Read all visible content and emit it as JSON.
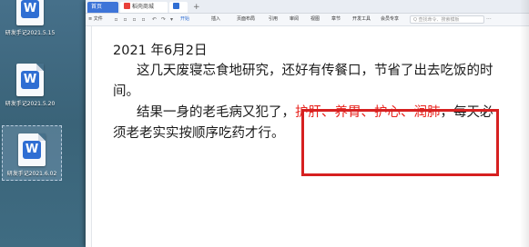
{
  "desktop": {
    "icons": [
      {
        "glyph": "W",
        "caption": "研发手记2021.5.15"
      },
      {
        "glyph": "W",
        "caption": "研发手记2021.5.20"
      },
      {
        "glyph": "W",
        "caption": "研发手记2021.6.02"
      }
    ]
  },
  "tabs": {
    "home": "首页",
    "doc": "稻壳商城",
    "doc_icon_color": "#e8403a",
    "w_tab": "W",
    "add": "+"
  },
  "menubar": {
    "file": "≡ 文件",
    "items": [
      "开始",
      "插入",
      "页面布局",
      "引用",
      "审阅",
      "视图",
      "章节",
      "开发工具",
      "会员专享"
    ],
    "search_placeholder": "Q 查找命令、搜索模板",
    "more": "···"
  },
  "document": {
    "date_line": "2021 年6月2日",
    "p1_line1": "这几天废寝忘食地研究，还好有传餐口，节省了出去吃饭的时",
    "p1_line2": "间。",
    "p2_line1_before": "结果一身的老毛病又犯了，",
    "p2_highlight": "护肝、养胃、护心、润肺",
    "p2_line1_after": "，每天必",
    "p2_line2": "须老老实实按顺序吃药才行。",
    "highlight_color": "#e8231d",
    "annotation_box_color": "#d62020"
  }
}
